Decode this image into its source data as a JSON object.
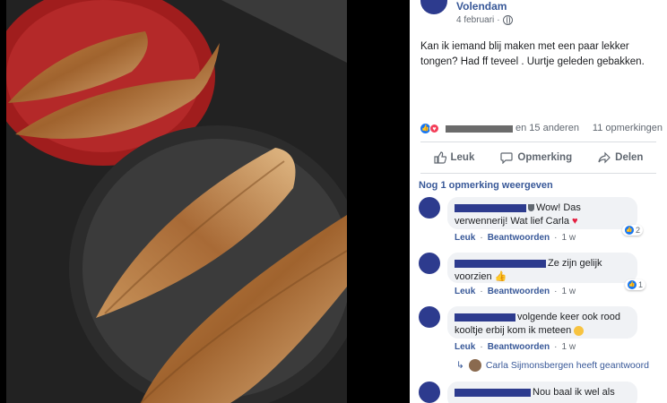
{
  "post": {
    "author": "Volendam",
    "date": "4 februari",
    "text": "Kan ik iemand blij maken met een paar lekker tongen? Had ff teveel . Uurtje geleden gebakken."
  },
  "reactions": {
    "others": "en 15 anderen",
    "comments_count": "11 opmerkingen"
  },
  "actions": {
    "like": "Leuk",
    "comment": "Opmerking",
    "share": "Delen"
  },
  "view_more": "Nog 1 opmerking weergeven",
  "comments": [
    {
      "text": "Wow! Das verwennerij! Wat lief Carla",
      "like": "Leuk",
      "reply": "Beantwoorden",
      "time": "1 w",
      "reactions": "2"
    },
    {
      "text": "Ze zijn gelijk voorzien",
      "like": "Leuk",
      "reply": "Beantwoorden",
      "time": "1 w",
      "reactions": "1"
    },
    {
      "text": "volgende keer ook rood kooltje erbij kom ik meteen",
      "like": "Leuk",
      "reply": "Beantwoorden",
      "time": "1 w"
    },
    {
      "text": "Nou baal ik wel als een"
    }
  ],
  "reply_summary": "Carla Sijmonsbergen heeft geantwoord",
  "colors": {
    "link": "#385898",
    "accent": "#1877f2",
    "bubble": "#f0f2f5"
  }
}
